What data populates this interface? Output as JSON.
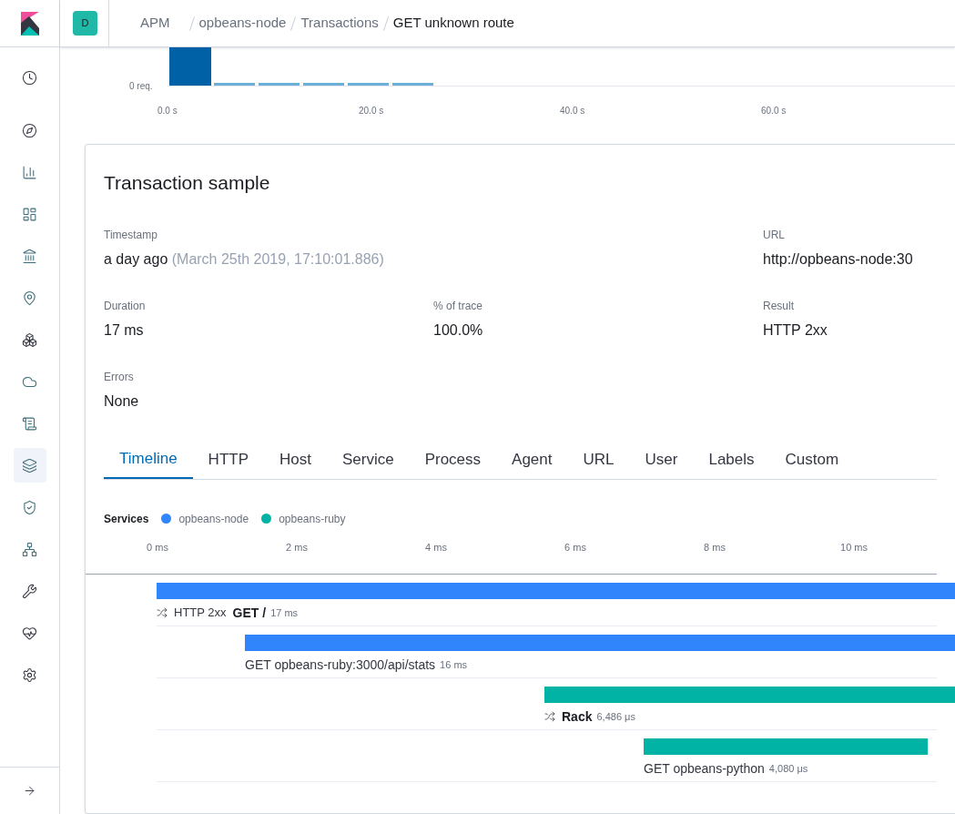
{
  "header": {
    "space_initial": "D",
    "breadcrumbs": [
      "APM",
      "opbeans-node",
      "Transactions",
      "GET unknown route"
    ]
  },
  "sidebar": {
    "items": [
      {
        "selected": false
      },
      {
        "selected": false
      },
      {
        "selected": false
      },
      {
        "selected": false
      },
      {
        "selected": false
      },
      {
        "selected": false
      },
      {
        "selected": false
      },
      {
        "selected": false
      },
      {
        "selected": false
      },
      {
        "selected": true
      },
      {
        "selected": false
      },
      {
        "selected": false
      },
      {
        "selected": false
      },
      {
        "selected": false
      },
      {
        "selected": false
      }
    ]
  },
  "histogram": {
    "y_tick": "0 req.",
    "x_ticks": [
      "0.0 s",
      "20.0 s",
      "40.0 s",
      "60.0 s"
    ]
  },
  "sample": {
    "title": "Transaction sample",
    "fields": [
      {
        "label": "Timestamp",
        "value": "a day ago",
        "note": "(March 25th 2019, 17:10:01.886)"
      },
      {
        "label": "URL",
        "value": "http://opbeans-node:30"
      },
      {
        "label": "Duration",
        "value": "17 ms"
      },
      {
        "label": "% of trace",
        "value": "100.0%"
      },
      {
        "label": "Result",
        "value": "HTTP 2xx"
      },
      {
        "label": "Errors",
        "value": "None"
      }
    ],
    "tabs": [
      {
        "label": "Timeline",
        "selected": true
      },
      {
        "label": "HTTP",
        "selected": false
      },
      {
        "label": "Host",
        "selected": false
      },
      {
        "label": "Service",
        "selected": false
      },
      {
        "label": "Process",
        "selected": false
      },
      {
        "label": "Agent",
        "selected": false
      },
      {
        "label": "URL",
        "selected": false
      },
      {
        "label": "User",
        "selected": false
      },
      {
        "label": "Labels",
        "selected": false
      },
      {
        "label": "Custom",
        "selected": false
      }
    ],
    "services_label": "Services",
    "services": [
      {
        "name": "opbeans-node",
        "color": "#3185fc"
      },
      {
        "name": "opbeans-ruby",
        "color": "#00b3a4"
      }
    ],
    "ticks": [
      "0 ms",
      "2 ms",
      "4 ms",
      "6 ms",
      "8 ms",
      "10 ms"
    ],
    "spans": [
      {
        "kind": "transaction",
        "color": "#3185fc",
        "result": "HTTP 2xx",
        "name": "GET /",
        "duration": "17 ms"
      },
      {
        "kind": "span",
        "color": "#3185fc",
        "name": "GET opbeans-ruby:3000/api/stats",
        "duration": "16 ms"
      },
      {
        "kind": "transaction",
        "color": "#00b3a4",
        "name": "Rack",
        "duration": "6,486 μs"
      },
      {
        "kind": "span",
        "color": "#00b3a4",
        "name": "GET opbeans-python",
        "duration": "4,080 μs"
      }
    ]
  }
}
